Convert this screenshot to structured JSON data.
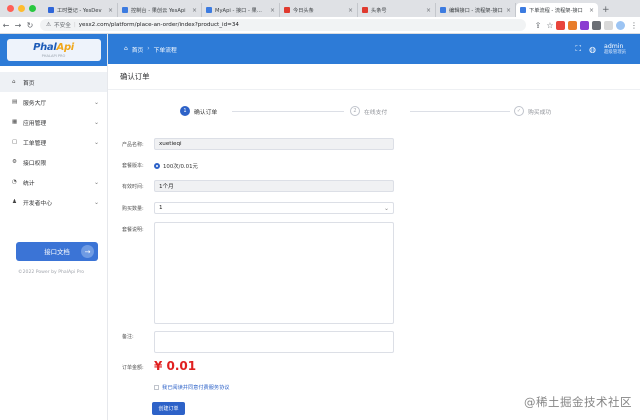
{
  "browser": {
    "tabs": [
      {
        "title": "工时登记 - YesDev",
        "color": "#2f66d9"
      },
      {
        "title": "控制台 - 果创云 YesApi",
        "color": "#3c7be0"
      },
      {
        "title": "MyApi - 接口 - 果创云",
        "color": "#3c7be0"
      },
      {
        "title": "今日头条",
        "color": "#e03a2f"
      },
      {
        "title": "头条号",
        "color": "#e03a2f"
      },
      {
        "title": "编辑接口 - 流程架-接口",
        "color": "#3c7be0"
      },
      {
        "title": "下单流程 - 流程架-接口",
        "color": "#3c7be0",
        "active": true
      }
    ],
    "insecure_label": "不安全",
    "url": "yesx2.com/platform/place-an-order/index?product_id=34"
  },
  "sidebar": {
    "logo_main": "Phal",
    "logo_accent": "Api",
    "logo_sub": "PHALAPI PRO",
    "items": [
      {
        "icon": "⌂",
        "label": "首页",
        "chevron": "",
        "active": true
      },
      {
        "icon": "▤",
        "label": "服务大厅",
        "chevron": "⌄"
      },
      {
        "icon": "▦",
        "label": "应用管理",
        "chevron": "⌄"
      },
      {
        "icon": "▢",
        "label": "工单管理",
        "chevron": "⌄"
      },
      {
        "icon": "⚙",
        "label": "接口权限",
        "chevron": ""
      },
      {
        "icon": "◔",
        "label": "统计",
        "chevron": "⌄"
      },
      {
        "icon": "♟",
        "label": "开发者中心",
        "chevron": "⌄"
      }
    ],
    "doc_button": "接口文档",
    "powered": "©2022 Power by PhalApi Pro"
  },
  "topbar": {
    "breadcrumb_home": "首页",
    "breadcrumb_current": "下单流程",
    "user_name": "admin",
    "user_role": "超级管理员"
  },
  "page": {
    "title": "确认订单",
    "steps": [
      {
        "num": "1",
        "label": "确认订单"
      },
      {
        "num": "2",
        "label": "在线支付"
      },
      {
        "num": "✓",
        "label": "购买成功"
      }
    ],
    "form": {
      "product_label": "产品名称:",
      "product_value": "xuetieqi",
      "version_label": "套餐版本:",
      "version_value": "100次/0.01元",
      "valid_label": "有效时间:",
      "valid_value": "1个月",
      "qty_label": "购买数量:",
      "qty_value": "1",
      "desc_label": "套餐说明:",
      "note_label": "备注:",
      "amount_label": "订单金额:",
      "amount_value": "¥ 0.01",
      "agree_text": "我已阅读并同意付费服务协议",
      "submit_label": "创建订单"
    }
  },
  "watermark": "@稀土掘金技术社区"
}
